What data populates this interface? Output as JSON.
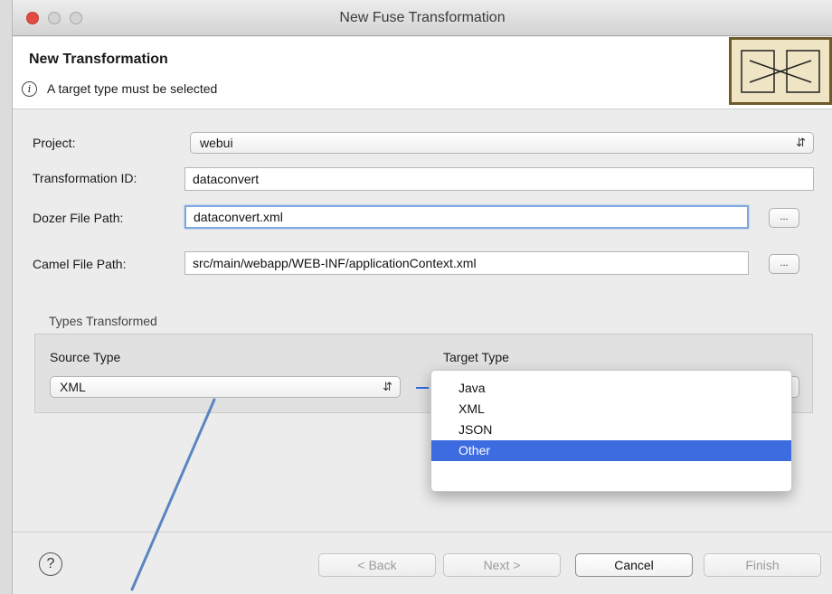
{
  "window": {
    "title": "New Fuse Transformation"
  },
  "banner": {
    "title": "New Transformation",
    "message": "A target type must be selected",
    "info_icon": "info-icon",
    "image_icon": "transformation-map-icon"
  },
  "form": {
    "project": {
      "label": "Project:",
      "value": "webui"
    },
    "transformation_id": {
      "label": "Transformation ID:",
      "value": "dataconvert"
    },
    "dozer_file": {
      "label": "Dozer File Path:",
      "value": "dataconvert.xml",
      "browse_label": "..."
    },
    "camel_file": {
      "label": "Camel File Path:",
      "value": "src/main/webapp/WEB-INF/applicationContext.xml",
      "browse_label": "..."
    }
  },
  "types": {
    "group_title": "Types Transformed",
    "source": {
      "label": "Source Type",
      "value": "XML"
    },
    "target": {
      "label": "Target Type",
      "options": [
        "Java",
        "XML",
        "JSON",
        "Other"
      ],
      "highlighted": "Other"
    }
  },
  "footer": {
    "help_icon": "help-icon",
    "back": "< Back",
    "next": "Next >",
    "cancel": "Cancel",
    "finish": "Finish"
  },
  "colors": {
    "accent": "#3d6be0",
    "close": "#e24b41",
    "annotation": "#5b85c0",
    "image_frame": "#6e5a2a"
  }
}
